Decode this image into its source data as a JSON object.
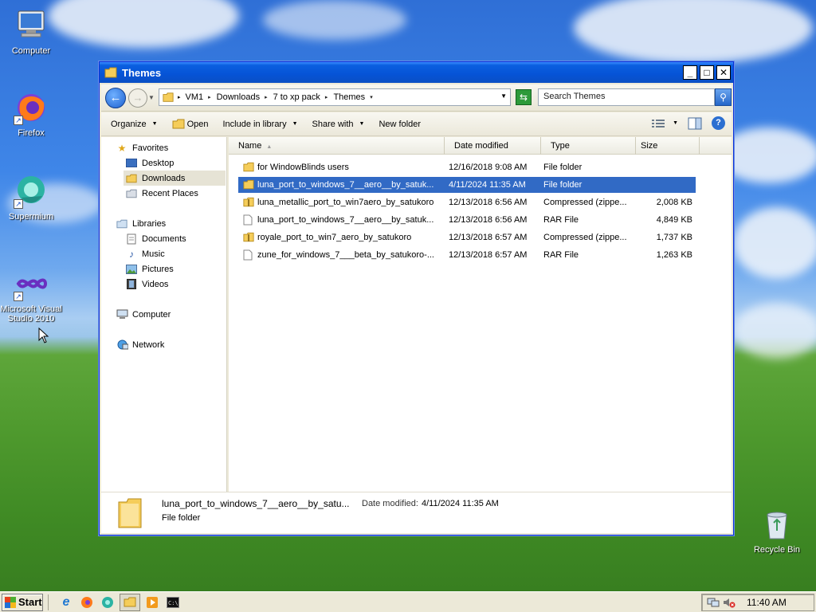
{
  "desktop": {
    "icons": [
      {
        "label": "Computer"
      },
      {
        "label": "Firefox"
      },
      {
        "label": "Supermium"
      },
      {
        "label": "Microsoft Visual Studio 2010"
      },
      {
        "label": "Recycle Bin"
      }
    ]
  },
  "window": {
    "title": "Themes",
    "controls": {
      "minimize": "_",
      "maximize": "□",
      "close": "✕"
    },
    "breadcrumbs": [
      "VM1",
      "Downloads",
      "7 to xp pack",
      "Themes"
    ],
    "search_placeholder": "Search Themes",
    "toolbar": {
      "organize": "Organize",
      "open": "Open",
      "include": "Include in library",
      "share": "Share with",
      "new_folder": "New folder"
    },
    "nav": {
      "favorites": "Favorites",
      "desktop": "Desktop",
      "downloads": "Downloads",
      "recent": "Recent Places",
      "libraries": "Libraries",
      "documents": "Documents",
      "music": "Music",
      "pictures": "Pictures",
      "videos": "Videos",
      "computer": "Computer",
      "network": "Network"
    },
    "columns": {
      "name": "Name",
      "date": "Date modified",
      "type": "Type",
      "size": "Size"
    },
    "files": [
      {
        "name": "for WindowBlinds users",
        "date": "12/16/2018 9:08 AM",
        "type": "File folder",
        "size": "",
        "icon": "folder-icon"
      },
      {
        "name": "luna_port_to_windows_7__aero__by_satuk...",
        "date": "4/11/2024 11:35 AM",
        "type": "File folder",
        "size": "",
        "icon": "folder-icon"
      },
      {
        "name": "luna_metallic_port_to_win7aero_by_satukoro",
        "date": "12/13/2018 6:56 AM",
        "type": "Compressed (zippe...",
        "size": "2,008 KB",
        "icon": "zip-folder-icon"
      },
      {
        "name": "luna_port_to_windows_7__aero__by_satuk...",
        "date": "12/13/2018 6:56 AM",
        "type": "RAR File",
        "size": "4,849 KB",
        "icon": "file-icon"
      },
      {
        "name": "royale_port_to_win7_aero_by_satukoro",
        "date": "12/13/2018 6:57 AM",
        "type": "Compressed (zippe...",
        "size": "1,737 KB",
        "icon": "zip-folder-icon"
      },
      {
        "name": "zune_for_windows_7___beta_by_satukoro-...",
        "date": "12/13/2018 6:57 AM",
        "type": "RAR File",
        "size": "1,263 KB",
        "icon": "file-icon"
      }
    ],
    "selected_index": 1,
    "details": {
      "name": "luna_port_to_windows_7__aero__by_satu...",
      "date_label": "Date modified:",
      "date_value": "4/11/2024 11:35 AM",
      "type": "File folder"
    }
  },
  "taskbar": {
    "start_label": "Start",
    "clock": "11:40 AM"
  },
  "colors": {
    "title_blue": "#0653d6",
    "selection": "#316ac5",
    "folder_yellow": "#f2c94c"
  }
}
